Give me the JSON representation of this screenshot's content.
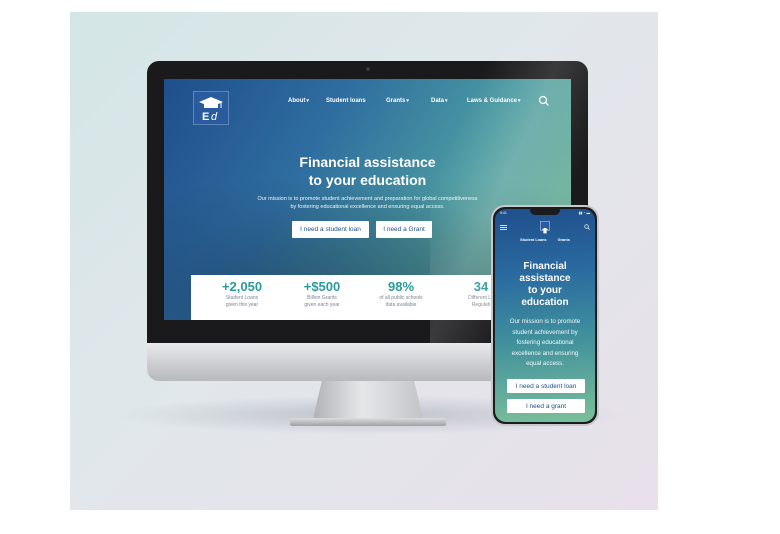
{
  "desktop": {
    "nav": {
      "items": [
        {
          "label": "About",
          "dropdown": true
        },
        {
          "label": "Student loans",
          "dropdown": false
        },
        {
          "label": "Grants",
          "dropdown": true
        },
        {
          "label": "Data",
          "dropdown": true
        },
        {
          "label": "Laws & Guidance",
          "dropdown": true
        }
      ],
      "dropdown_glyph": "▾",
      "search_icon": "search-icon"
    },
    "hero": {
      "title_line1": "Financial assistance",
      "title_line2": "to your education",
      "subtitle_line1": "Our mission is to promote student achievement and preparation for global competitiveness",
      "subtitle_line2": "by fostering educational excellence and ensuring equal access.",
      "buttons": [
        "I need a student loan",
        "I need a Grant"
      ]
    },
    "stats": [
      {
        "value": "+2,050",
        "label_line1": "Student Loans",
        "label_line2": "given this year"
      },
      {
        "value": "+$500",
        "label_line1": "Billion Grants",
        "label_line2": "given each year"
      },
      {
        "value": "98%",
        "label_line1": "of all public schools",
        "label_line2": "data available"
      },
      {
        "value": "34",
        "label_line1": "Different La",
        "label_line2": "Regulati"
      }
    ]
  },
  "mobile": {
    "status": {
      "time": "9:41",
      "icons": "▮▮ ◔ ▬"
    },
    "tabs": [
      "Student Loans",
      "Grants"
    ],
    "hero": {
      "title_lines": [
        "Financial",
        "assistance",
        "to your",
        "education"
      ],
      "subtitle_lines": [
        "Our mission is to promote",
        "student achievement by",
        "fostering educational",
        "excellence and ensuring",
        "equal access."
      ],
      "buttons": [
        "I need a student loan",
        "I need a grant"
      ]
    }
  },
  "colors": {
    "brand_blue": "#1f4f8c",
    "accent_teal": "#2b9a9a",
    "logo_blue": "#2a5b9e"
  }
}
